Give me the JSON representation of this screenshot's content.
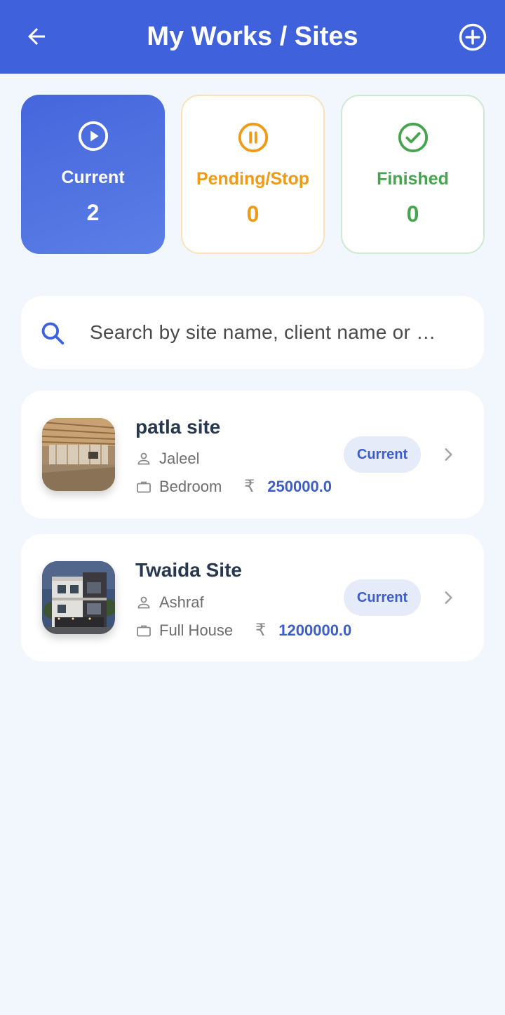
{
  "header": {
    "title": "My Works / Sites",
    "back_icon": "arrow-left-icon",
    "add_icon": "plus-circle-icon",
    "background_color": "#3F62DC"
  },
  "stats": [
    {
      "key": "current",
      "label": "Current",
      "count": "2",
      "icon": "play-circle-icon",
      "color": "#FFFFFF",
      "bg": "#4566DC"
    },
    {
      "key": "pending",
      "label": "Pending/Stop",
      "count": "0",
      "icon": "pause-circle-icon",
      "color": "#F09A16"
    },
    {
      "key": "finished",
      "label": "Finished",
      "count": "0",
      "icon": "check-circle-icon",
      "color": "#46A44C"
    }
  ],
  "search": {
    "placeholder": "Search by site name, client name or …",
    "icon": "search-icon"
  },
  "sites": [
    {
      "name": "patla site",
      "client": "Jaleel",
      "work_type": "Bedroom",
      "currency": "₹",
      "amount": "250000.0",
      "status": "Current",
      "thumbnail": "interior-construction-photo"
    },
    {
      "name": "Twaida Site",
      "client": "Ashraf",
      "work_type": "Full House",
      "currency": "₹",
      "amount": "1200000.0",
      "status": "Current",
      "thumbnail": "house-exterior-photo"
    }
  ],
  "colors": {
    "accent": "#3F62DC",
    "page_bg": "#F2F6FD",
    "amount": "#3D5DC8",
    "badge_bg": "#E6EBFA"
  }
}
